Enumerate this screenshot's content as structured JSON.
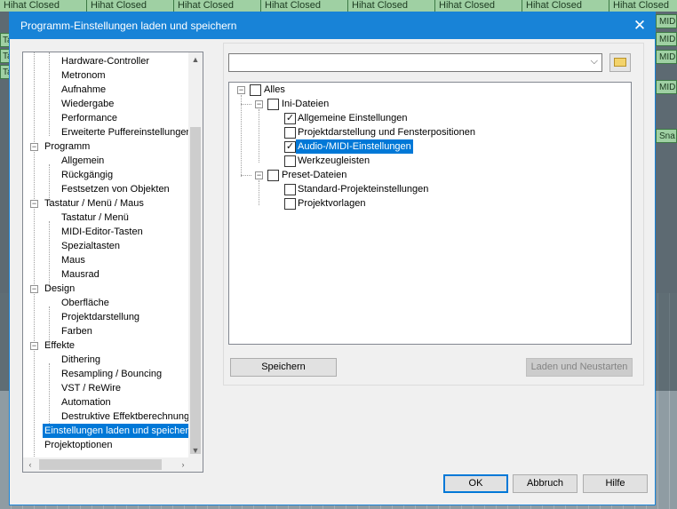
{
  "background": {
    "clip_label": "Hihat Closed",
    "right_labels": [
      "MID",
      "MID",
      "MID",
      "MID",
      "Sna"
    ],
    "left_labels": [
      "Ta",
      "Ta",
      "Ta"
    ]
  },
  "dialog": {
    "title": "Programm-Einstellungen laden und speichern",
    "close_glyph": "✕"
  },
  "tree": {
    "items": [
      {
        "label": "Hardware-Controller"
      },
      {
        "label": "Metronom"
      },
      {
        "label": "Aufnahme"
      },
      {
        "label": "Wiedergabe"
      },
      {
        "label": "Performance"
      },
      {
        "label": "Erweiterte Puffereinstellungen"
      },
      {
        "label": "Programm"
      },
      {
        "label": "Allgemein"
      },
      {
        "label": "Rückgängig"
      },
      {
        "label": "Festsetzen von Objekten"
      },
      {
        "label": "Tastatur / Menü / Maus"
      },
      {
        "label": "Tastatur / Menü"
      },
      {
        "label": "MIDI-Editor-Tasten"
      },
      {
        "label": "Spezialtasten"
      },
      {
        "label": "Maus"
      },
      {
        "label": "Mausrad"
      },
      {
        "label": "Design"
      },
      {
        "label": "Oberfläche"
      },
      {
        "label": "Projektdarstellung"
      },
      {
        "label": "Farben"
      },
      {
        "label": "Effekte"
      },
      {
        "label": "Dithering"
      },
      {
        "label": "Resampling / Bouncing"
      },
      {
        "label": "VST / ReWire"
      },
      {
        "label": "Automation"
      },
      {
        "label": "Destruktive Effektberechnung"
      },
      {
        "label": "Einstellungen laden und speichern"
      },
      {
        "label": "Projektoptionen"
      }
    ]
  },
  "combo": {
    "value": ""
  },
  "checklist": {
    "items": [
      {
        "label": "Alles",
        "checked": false
      },
      {
        "label": "Ini-Dateien",
        "checked": false
      },
      {
        "label": "Allgemeine Einstellungen",
        "checked": true
      },
      {
        "label": "Projektdarstellung und Fensterpositionen",
        "checked": false
      },
      {
        "label": "Audio-/MIDI-Einstellungen",
        "checked": true
      },
      {
        "label": "Werkzeugleisten",
        "checked": false
      },
      {
        "label": "Preset-Dateien",
        "checked": false
      },
      {
        "label": "Standard-Projekteinstellungen",
        "checked": false
      },
      {
        "label": "Projektvorlagen",
        "checked": false
      }
    ],
    "check_glyph": "✓"
  },
  "buttons": {
    "save": "Speichern",
    "load_restart": "Laden und Neustarten",
    "ok": "OK",
    "cancel": "Abbruch",
    "help": "Hilfe"
  }
}
